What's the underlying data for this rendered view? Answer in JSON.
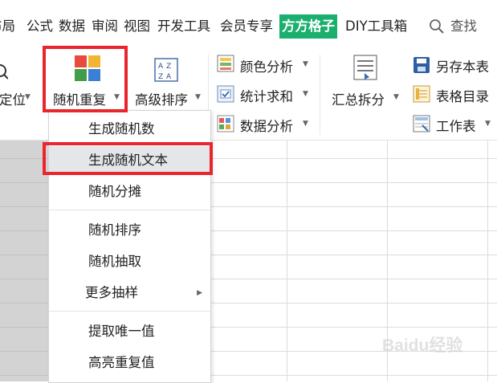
{
  "tabs": [
    {
      "label": "布局"
    },
    {
      "label": "公式"
    },
    {
      "label": "数据"
    },
    {
      "label": "审阅"
    },
    {
      "label": "视图"
    },
    {
      "label": "开发工具"
    },
    {
      "label": "会员专享"
    },
    {
      "label": "方方格子",
      "active": true
    },
    {
      "label": "DIY工具箱"
    }
  ],
  "search": {
    "label": "查找",
    "icon": "search-icon"
  },
  "ribbon": {
    "locate_label": "定位",
    "random_repeat_label": "随机重复",
    "advanced_sort_label": "高级排序",
    "color_analysis_label": "颜色分析",
    "stat_sum_label": "统计求和",
    "data_analysis_label": "数据分析",
    "summary_split_label": "汇总拆分",
    "save_as_label": "另存本表",
    "sheet_index_label": "表格目录",
    "worksheet_label": "工作表"
  },
  "menu": {
    "items": [
      {
        "label": "生成随机数"
      },
      {
        "label": "生成随机文本",
        "highlighted": true
      },
      {
        "label": "随机分摊"
      },
      {
        "label": "随机排序"
      },
      {
        "label": "随机抽取"
      },
      {
        "label": "更多抽样",
        "submenu": true
      },
      {
        "label": "提取唯一值"
      },
      {
        "label": "高亮重复值"
      }
    ]
  },
  "watermark": {
    "text": "Baidu经验"
  },
  "colors": {
    "accent_green": "#1aaf6e",
    "highlight_red": "#e8262c",
    "menu_hover": "#e4e6ea"
  }
}
